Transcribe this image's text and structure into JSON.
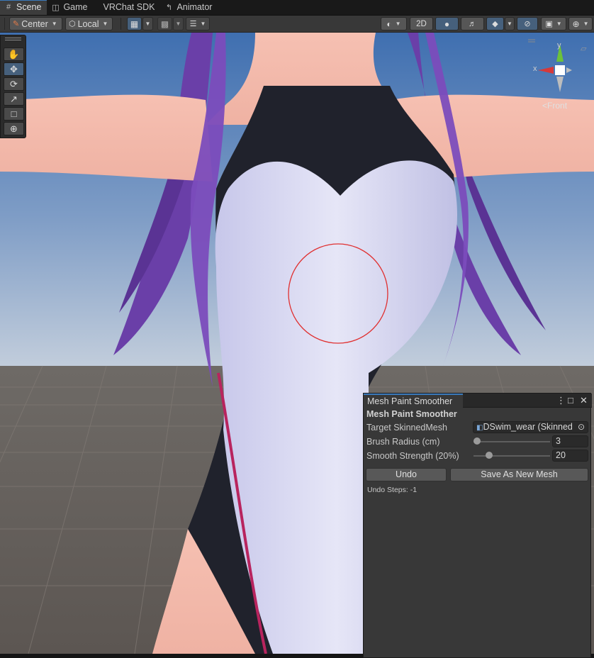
{
  "tabs": [
    {
      "label": "Scene",
      "icon": "grid-icon",
      "active": true
    },
    {
      "label": "Game",
      "icon": "gamepad-icon",
      "active": false
    },
    {
      "label": "VRChat SDK",
      "icon": "",
      "active": false
    },
    {
      "label": "Animator",
      "icon": "animator-icon",
      "active": false
    }
  ],
  "toolbar": {
    "pivot_label": "Center",
    "rotation_label": "Local",
    "twod_label": "2D"
  },
  "gizmo": {
    "y_label": "y",
    "x_label": "x",
    "view_label": "Front",
    "colors": {
      "y": "#6cc23a",
      "x": "#d6393a",
      "z": "#cfcfcf"
    }
  },
  "panel": {
    "tab_title": "Mesh Paint Smoother",
    "header": "Mesh Paint Smoother",
    "target_label": "Target SkinnedMesh",
    "target_value": "DSwim_wear (Skinned",
    "radius_label": "Brush Radius (cm)",
    "radius_value": "3",
    "radius_fraction": 0.05,
    "strength_label": "Smooth Strength (20%)",
    "strength_value": "20",
    "strength_fraction": 0.2,
    "undo_label": "Undo",
    "save_label": "Save As New Mesh",
    "undo_steps": "Undo Steps: -1"
  },
  "colors": {
    "accent": "#3a79bb",
    "brush": "#e03030"
  }
}
